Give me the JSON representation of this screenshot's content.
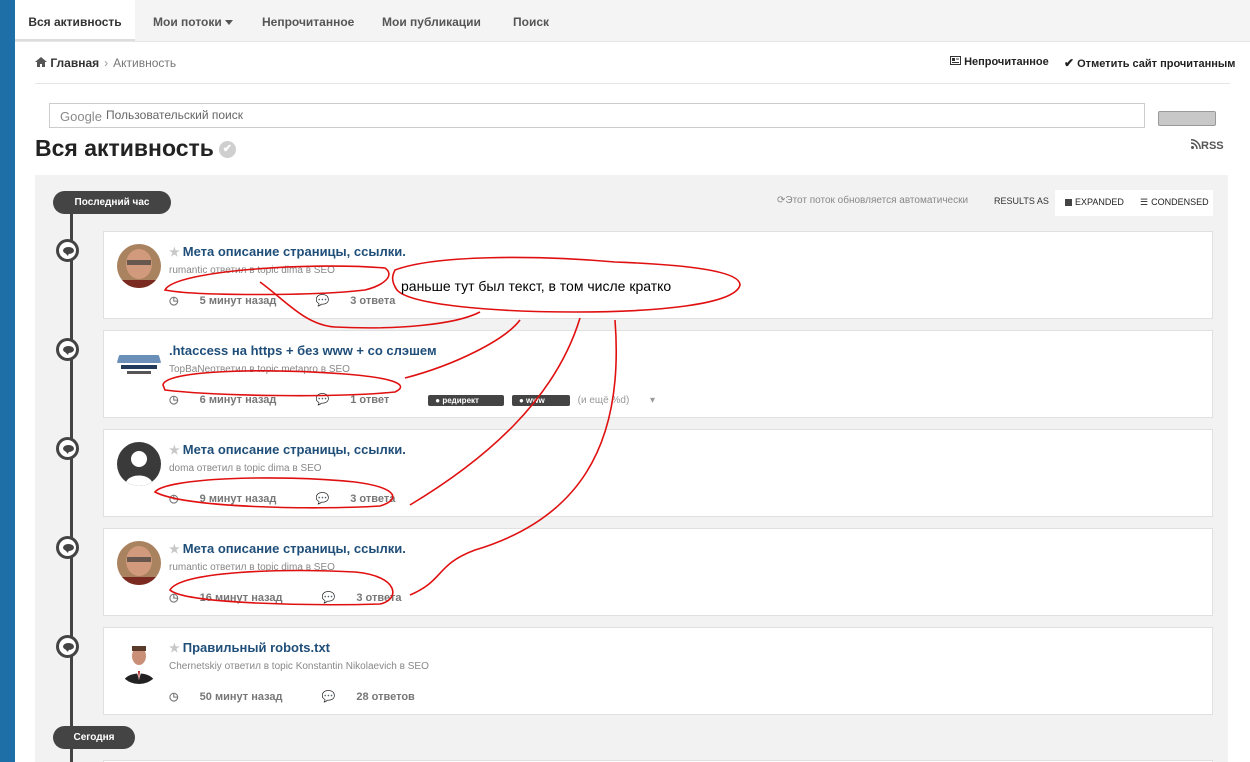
{
  "tabs": [
    {
      "label": "Вся активность",
      "active": true
    },
    {
      "label": "Мои потоки",
      "dropdown": true
    },
    {
      "label": "Непрочитанное"
    },
    {
      "label": "Мои публикации"
    },
    {
      "label": "Поиск"
    }
  ],
  "breadcrumb": {
    "home": "Главная",
    "current": "Активность"
  },
  "actions": {
    "unread": "Непрочитанное",
    "mark_read": "Отметить сайт прочитанным"
  },
  "search": {
    "brand": "Google",
    "placeholder": "Пользовательский поиск"
  },
  "page": {
    "title": "Вся активность",
    "rss": "RSS"
  },
  "stream": {
    "section_hour": "Последний час",
    "section_today": "Сегодня",
    "auto_update": "Этот поток обновляется автоматически",
    "results_as": "RESULTS AS",
    "expanded": "EXPANDED",
    "condensed": "CONDENSED"
  },
  "items": [
    {
      "title": "Мета описание страницы, ссылки.",
      "sub": "rumantic ответил в topic dima в SEO",
      "time": "5 минут назад",
      "replies": "3 ответа",
      "avatar": "photo-man"
    },
    {
      "title": ".htaccess на https + без www + со слэшем",
      "sub": "TopBaNeответил в topic metapro в SEO",
      "time": "6 минут назад",
      "replies": "1 ответ",
      "tags": [
        "редирект",
        "www"
      ],
      "more": "(и ещё %d)",
      "avatar": "studio-logo"
    },
    {
      "title": "Мета описание страницы, ссылки.",
      "sub": "doma ответил в topic dima в SEO",
      "time": "9 минут назад",
      "replies": "3 ответа",
      "avatar": "default-user"
    },
    {
      "title": "Мета описание страницы, ссылки.",
      "sub": "rumantic ответил в topic dima в SEO",
      "time": "16 минут назад",
      "replies": "3 ответа",
      "avatar": "photo-man"
    },
    {
      "title": "Правильный robots.txt",
      "sub": "Chernetskiy ответил в topic Konstantin Nikolaevich в SEO",
      "time": "50 минут назад",
      "replies": "28 ответов",
      "avatar": "photo-suit"
    }
  ],
  "annotation": {
    "text": "раньше тут был текст, в том числе кратко",
    "color": "#e01010"
  },
  "colors": {
    "accent": "#1e6fa8",
    "link": "#1f4e79",
    "timeline": "#444444"
  }
}
